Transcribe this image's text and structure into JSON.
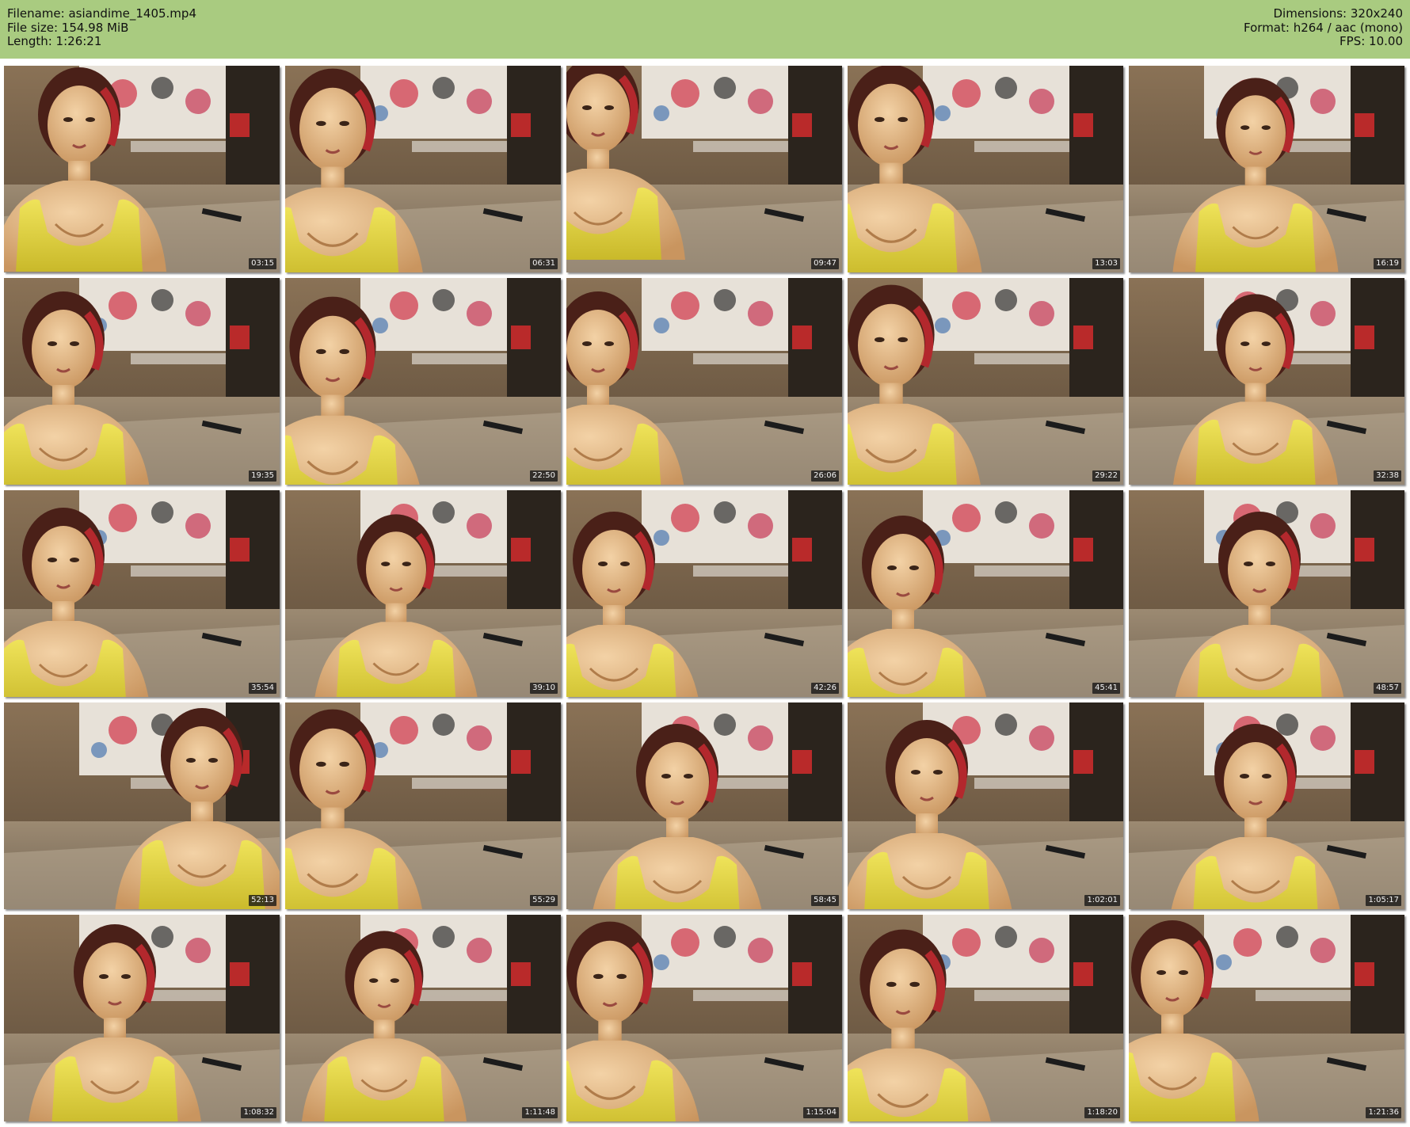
{
  "header": {
    "filename": "Filename: asiandime_1405.mp4",
    "filesize": "File size: 154.98 MiB",
    "length": "Length: 1:26:21",
    "dimensions": "Dimensions: 320x240",
    "format": "Format: h264 / aac (mono)",
    "fps": "FPS: 10.00",
    "background": "#a9cb80"
  },
  "thumbnails": [
    {
      "time": "03:15"
    },
    {
      "time": "06:31"
    },
    {
      "time": "09:47"
    },
    {
      "time": "13:03"
    },
    {
      "time": "16:19"
    },
    {
      "time": "19:35"
    },
    {
      "time": "22:50"
    },
    {
      "time": "26:06"
    },
    {
      "time": "29:22"
    },
    {
      "time": "32:38"
    },
    {
      "time": "35:54"
    },
    {
      "time": "39:10"
    },
    {
      "time": "42:26"
    },
    {
      "time": "45:41"
    },
    {
      "time": "48:57"
    },
    {
      "time": "52:13"
    },
    {
      "time": "55:29"
    },
    {
      "time": "58:45"
    },
    {
      "time": "1:02:01"
    },
    {
      "time": "1:05:17"
    },
    {
      "time": "1:08:32"
    },
    {
      "time": "1:11:48"
    },
    {
      "time": "1:15:04"
    },
    {
      "time": "1:18:20"
    },
    {
      "time": "1:21:36"
    }
  ]
}
